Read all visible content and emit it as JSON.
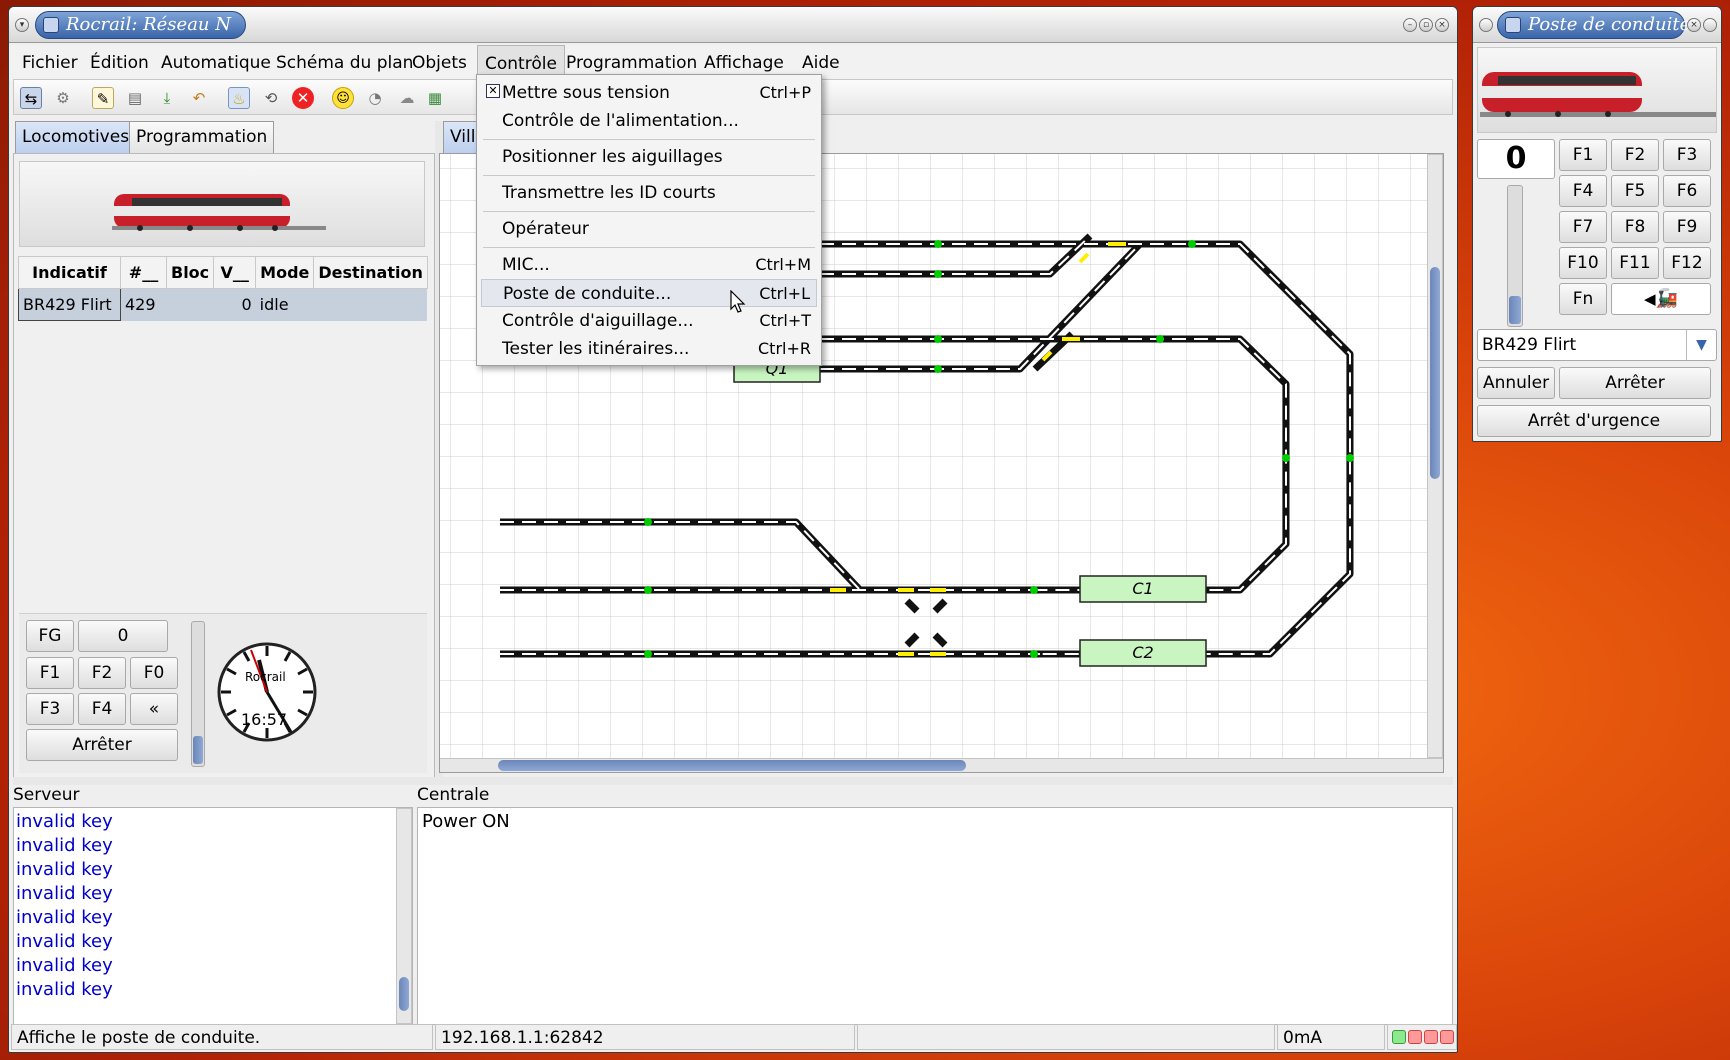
{
  "main_window": {
    "title": "Rocrail: Réseau N",
    "menu": [
      "Fichier",
      "Édition",
      "Automatique",
      "Schéma du plan",
      "Objets",
      "Contrôle",
      "Programmation",
      "Affichage",
      "Aide"
    ],
    "active_menu": "Contrôle",
    "left_tabs": [
      "Locomotives",
      "Programmation"
    ],
    "plan_tab": "Ville",
    "loco_table": {
      "headers": [
        "Indicatif",
        "#__",
        "Bloc",
        "V__",
        "Mode",
        "Destination"
      ],
      "rows": [
        {
          "id": "BR429 Flirt",
          "addr": "429",
          "bloc": "",
          "speed": "0",
          "mode": "idle",
          "dest": ""
        }
      ]
    },
    "mini_throttle": {
      "fg_label": "FG",
      "speed": "0",
      "f1": "F1",
      "f2": "F2",
      "f0": "F0",
      "f3": "F3",
      "f4": "F4",
      "back": "«",
      "stop": "Arrêter"
    },
    "clock": {
      "brand": "Rocrail",
      "time": "16:57"
    },
    "blocks": {
      "c1": "C1",
      "c2": "C2",
      "q1": "Q1"
    },
    "server_panel": {
      "title": "Serveur",
      "lines": [
        "invalid key",
        "invalid key",
        "invalid key",
        "invalid key",
        "invalid key",
        "invalid key",
        "invalid key",
        "invalid key"
      ]
    },
    "central_panel": {
      "title": "Centrale",
      "lines": [
        "Power ON"
      ]
    },
    "status": {
      "message": "Affiche le poste de conduite.",
      "address": "192.168.1.1:62842",
      "current": "0mA"
    }
  },
  "control_menu": [
    {
      "label": "Mettre sous tension",
      "accel": "Ctrl+P",
      "checked": true
    },
    {
      "label": "Contrôle de l'alimentation...",
      "accel": ""
    },
    {
      "label": "Positionner les aiguillages",
      "accel": ""
    },
    {
      "label": "Transmettre les ID courts",
      "accel": ""
    },
    {
      "label": "Opérateur",
      "accel": ""
    },
    {
      "label": "MIC...",
      "accel": "Ctrl+M"
    },
    {
      "label": "Poste de conduite...",
      "accel": "Ctrl+L"
    },
    {
      "label": "Contrôle d'aiguillage...",
      "accel": "Ctrl+T"
    },
    {
      "label": "Tester les itinéraires...",
      "accel": "Ctrl+R"
    }
  ],
  "cab_window": {
    "title": "Poste de conduite",
    "speed": "0",
    "functions": [
      "F1",
      "F2",
      "F3",
      "F4",
      "F5",
      "F6",
      "F7",
      "F8",
      "F9",
      "F10",
      "F11",
      "F12",
      "Fn"
    ],
    "loco": "BR429 Flirt",
    "cancel": "Annuler",
    "stop": "Arrêter",
    "emergency": "Arrêt d'urgence"
  },
  "colors": {
    "accent": "#3a64a8",
    "track": "#111111",
    "block": "#c8f5c0",
    "sensor_on": "#00cc00",
    "sensor_active": "#ffee00",
    "log_text": "#0000cc"
  }
}
